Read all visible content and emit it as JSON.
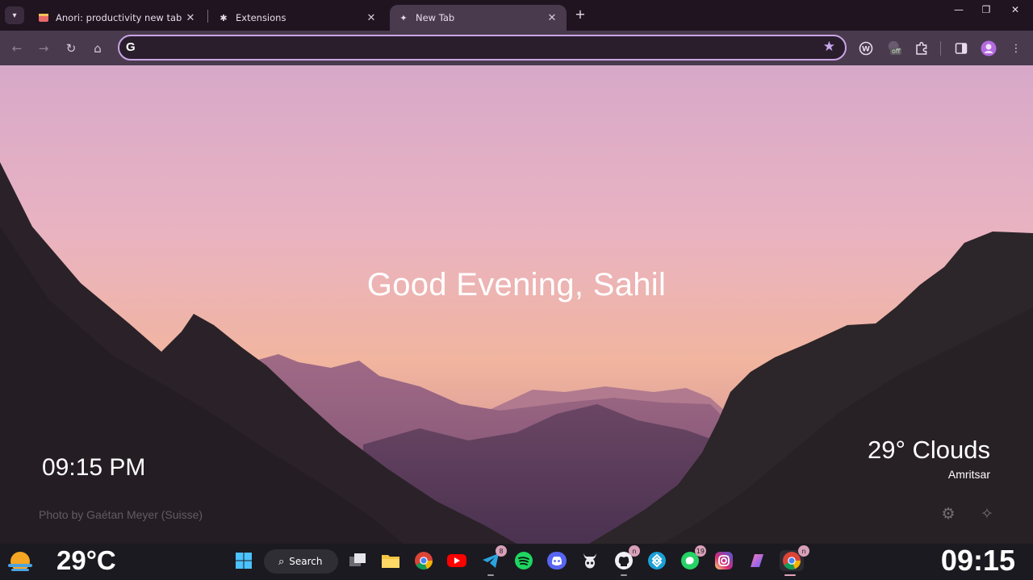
{
  "browser": {
    "tabs": [
      {
        "title": "Anori: productivity new tab - C",
        "icon": "anori-favicon-icon",
        "active": false
      },
      {
        "title": "Extensions",
        "icon": "puzzle-icon",
        "active": false
      },
      {
        "title": "New Tab",
        "icon": "sparkle-icon",
        "active": true
      }
    ],
    "omnibox": {
      "value": "",
      "search_engine_glyph": "G"
    },
    "extension_badge": "off"
  },
  "newtab": {
    "greeting": "Good Evening, Sahil",
    "clock": "09:15 PM",
    "photo_credit": "Photo by Gaétan Meyer (Suisse)",
    "weather": {
      "summary": "29° Clouds",
      "city": "Amritsar"
    }
  },
  "taskbar": {
    "temperature": "29°C",
    "search_label": "Search",
    "clock": "09:15",
    "badges": {
      "telegram": "8",
      "whatsapp": "19",
      "github": "n",
      "chrome": "n"
    }
  },
  "colors": {
    "accent": "#c9a6e6",
    "toolbar": "#4a3a4e",
    "tabstrip": "#1f1420",
    "sky_top": "#d8aac9",
    "sky_horizon": "#f0b49a"
  }
}
